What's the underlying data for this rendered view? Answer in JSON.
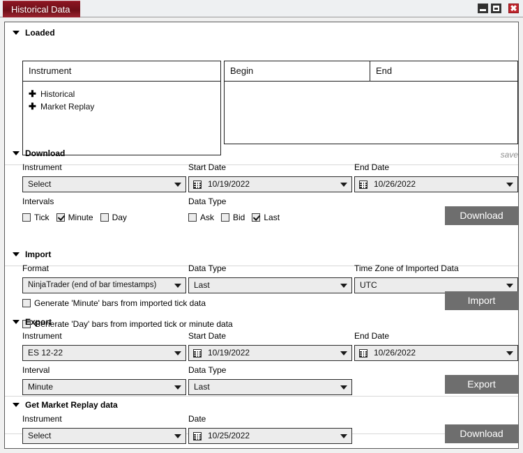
{
  "window": {
    "tab_title": "Historical Data",
    "controls": {
      "minimize": "minimize-button",
      "maximize": "maximize-button",
      "close_glyph": "✖"
    }
  },
  "sections": {
    "loaded": {
      "title": "Loaded",
      "tree_header": "Instrument",
      "tree_items": [
        {
          "expander": "✚",
          "label": "Historical"
        },
        {
          "expander": "✚",
          "label": "Market Replay"
        }
      ],
      "grid_headers": [
        "Begin",
        "End"
      ],
      "grid_rows": [],
      "save_label": "save"
    },
    "download": {
      "title": "Download",
      "instrument_label": "Instrument",
      "instrument_value": "Select",
      "start_date_label": "Start Date",
      "start_date_value": "10/19/2022",
      "end_date_label": "End Date",
      "end_date_value": "10/26/2022",
      "intervals_label": "Intervals",
      "intervals": [
        {
          "label": "Tick",
          "checked": false
        },
        {
          "label": "Minute",
          "checked": true
        },
        {
          "label": "Day",
          "checked": false
        }
      ],
      "data_type_label": "Data Type",
      "data_types": [
        {
          "label": "Ask",
          "checked": false
        },
        {
          "label": "Bid",
          "checked": false
        },
        {
          "label": "Last",
          "checked": true
        }
      ],
      "button_label": "Download"
    },
    "import": {
      "title": "Import",
      "format_label": "Format",
      "format_value": "NinjaTrader (end of bar timestamps)",
      "data_type_label": "Data Type",
      "data_type_value": "Last",
      "timezone_label": "Time Zone of Imported Data",
      "timezone_value": "UTC",
      "options": [
        {
          "label": "Generate 'Minute' bars from imported tick data",
          "checked": false
        },
        {
          "label": "Generate 'Day' bars from imported tick or minute data",
          "checked": false
        }
      ],
      "button_label": "Import"
    },
    "export": {
      "title": "Export",
      "instrument_label": "Instrument",
      "instrument_value": "ES 12-22",
      "start_date_label": "Start Date",
      "start_date_value": "10/19/2022",
      "end_date_label": "End Date",
      "end_date_value": "10/26/2022",
      "interval_label": "Interval",
      "interval_value": "Minute",
      "data_type_label": "Data Type",
      "data_type_value": "Last",
      "button_label": "Export"
    },
    "market_replay": {
      "title": "Get Market Replay data",
      "instrument_label": "Instrument",
      "instrument_value": "Select",
      "date_label": "Date",
      "date_value": "10/25/2022",
      "button_label": "Download"
    }
  },
  "colors": {
    "tab_accent": "#7a1220",
    "close_button": "#c1252c",
    "button_face": "#6e6e6e",
    "field_face": "#ececec",
    "panel_bg": "#ffffff",
    "window_bg": "#f0f0f0"
  }
}
